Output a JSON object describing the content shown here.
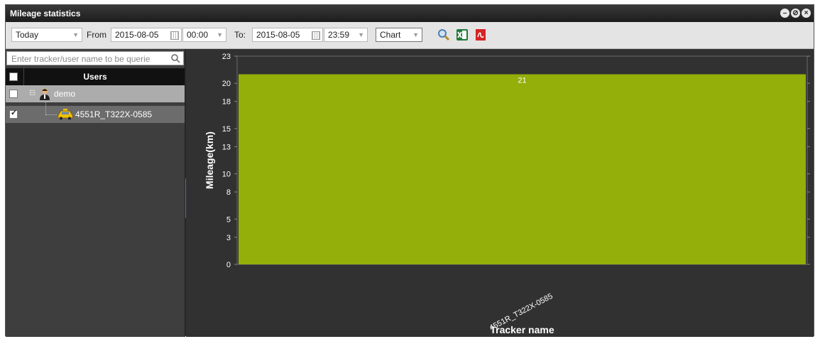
{
  "window": {
    "title": "Mileage statistics"
  },
  "toolbar": {
    "period": "Today",
    "from_label": "From",
    "from_date": "2015-08-05",
    "from_time": "00:00",
    "to_label": "To:",
    "to_date": "2015-08-05",
    "to_time": "23:59",
    "view_mode": "Chart",
    "icons": [
      "search-icon",
      "excel-export-icon",
      "pdf-export-icon"
    ]
  },
  "sidebar": {
    "search_placeholder": "Enter tracker/user name to be querie",
    "header": "Users",
    "tree": [
      {
        "label": "demo",
        "checked": false,
        "icon": "user-icon"
      },
      {
        "label": "4551R_T322X-0585",
        "checked": true,
        "icon": "taxi-icon"
      }
    ]
  },
  "chart_data": {
    "type": "bar",
    "categories": [
      "4551R_T322X-0585"
    ],
    "values": [
      21
    ],
    "data_labels": [
      "21"
    ],
    "xlabel": "Tracker name",
    "ylabel": "Mileage(km)",
    "ylim": [
      0,
      23
    ],
    "yticks": [
      "0",
      "3",
      "5",
      "8",
      "10",
      "13",
      "15",
      "18",
      "20",
      "23"
    ],
    "bar_color": "#94ae0a",
    "grid": false
  }
}
